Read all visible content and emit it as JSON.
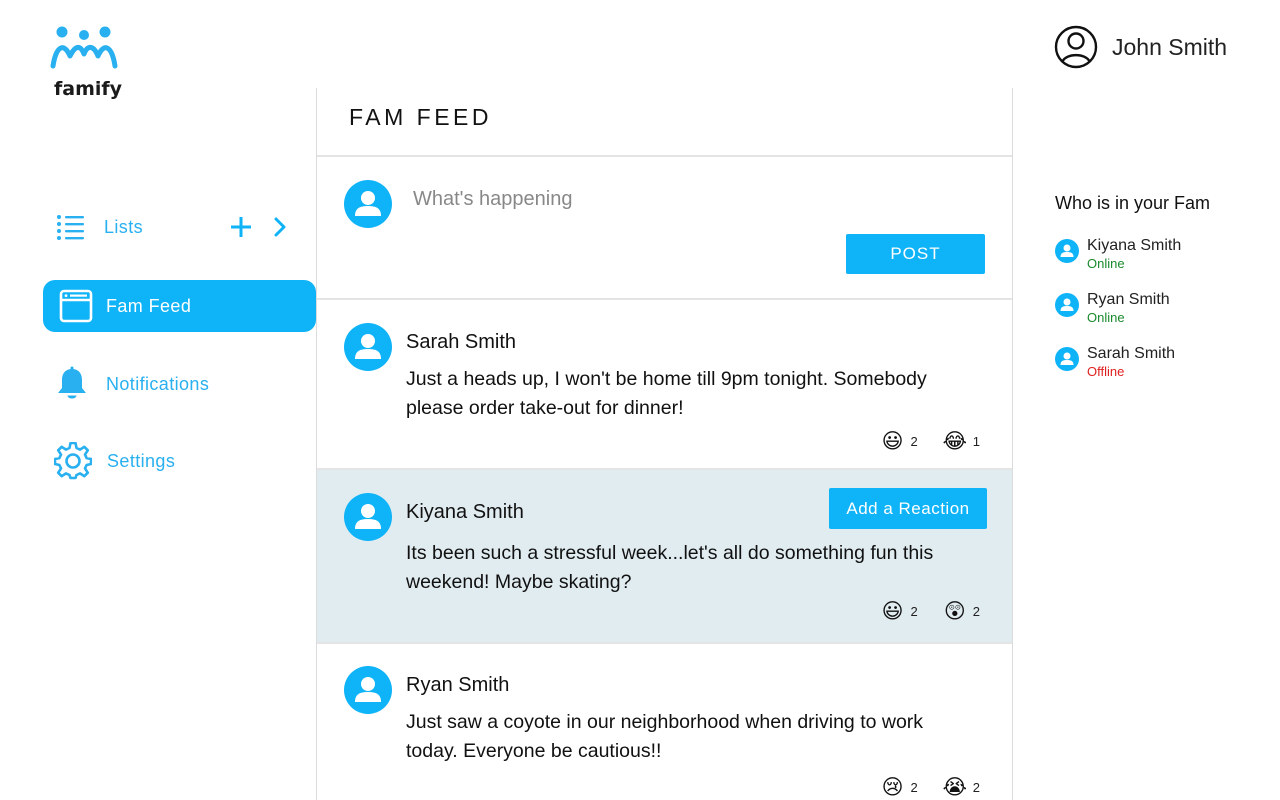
{
  "app": {
    "logo_text": "famify"
  },
  "user": {
    "name": "John Smith",
    "icon": "user-circle-icon"
  },
  "sidebar": {
    "items": [
      {
        "label": "Lists",
        "icon": "list-icon",
        "active": false
      },
      {
        "label": "Fam Feed",
        "icon": "browser-window-icon",
        "active": true
      },
      {
        "label": "Notifications",
        "icon": "bell-icon",
        "active": false
      },
      {
        "label": "Settings",
        "icon": "gear-icon",
        "active": false
      }
    ],
    "lists_actions": {
      "add_icon": "plus-icon",
      "expand_icon": "chevron-right-icon"
    }
  },
  "feed": {
    "title": "FAM FEED",
    "composer": {
      "placeholder": "What's happening",
      "value": "",
      "post_label": "POST"
    },
    "add_reaction_label": "Add a Reaction",
    "posts": [
      {
        "author": "Sarah Smith",
        "text": "Just a heads up, I won't be home till 9pm tonight. Somebody please order take-out for dinner!",
        "reactions": [
          {
            "emoji": "😃",
            "name": "smiley-emoji",
            "count": "2"
          },
          {
            "emoji": "😂",
            "name": "tears-of-joy-emoji",
            "count": "1"
          }
        ]
      },
      {
        "author": "Kiyana Smith",
        "text": "Its been such a stressful week...let's all do something fun this weekend! Maybe skating?",
        "highlighted": true,
        "reactions": [
          {
            "emoji": "😃",
            "name": "smiley-emoji",
            "count": "2"
          },
          {
            "emoji": "😲",
            "name": "astonished-emoji",
            "count": "2"
          }
        ]
      },
      {
        "author": "Ryan Smith",
        "text": "Just saw a coyote in our neighborhood when driving to work today. Everyone be cautious!!",
        "reactions": [
          {
            "emoji": "😢",
            "name": "crying-emoji",
            "count": "2"
          },
          {
            "emoji": "😭",
            "name": "sobbing-emoji",
            "count": "2"
          }
        ]
      }
    ]
  },
  "fam": {
    "title": "Who is in your Fam",
    "members": [
      {
        "name": "Kiyana Smith",
        "status": "Online",
        "status_color": "#1a8a2e"
      },
      {
        "name": "Ryan Smith",
        "status": "Online",
        "status_color": "#1a8a2e"
      },
      {
        "name": "Sarah Smith",
        "status": "Offline",
        "status_color": "#e02020"
      }
    ]
  },
  "colors": {
    "accent": "#0fb3f7",
    "highlight_bg": "#e1ecf1"
  }
}
